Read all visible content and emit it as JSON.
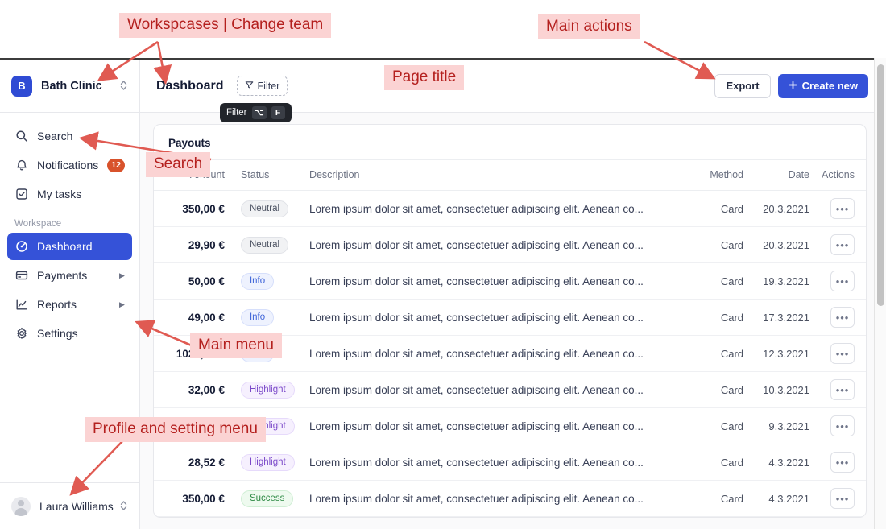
{
  "annotations": [
    {
      "id": "workspaces",
      "text": "Workspcases | Change team"
    },
    {
      "id": "main_actions",
      "text": "Main actions"
    },
    {
      "id": "page_title",
      "text": "Page title"
    },
    {
      "id": "search",
      "text": "Search"
    },
    {
      "id": "main_menu",
      "text": "Main menu"
    },
    {
      "id": "profile_menu",
      "text": "Profile and setting menu"
    }
  ],
  "sidebar": {
    "workspace": {
      "initial": "B",
      "name": "Bath Clinic",
      "switch_icon": "chevron-up-down-icon"
    },
    "top_items": [
      {
        "icon": "search-icon",
        "label": "Search"
      },
      {
        "icon": "bell-icon",
        "label": "Notifications",
        "badge": "12"
      },
      {
        "icon": "check-square-icon",
        "label": "My tasks"
      }
    ],
    "section_label": "Workspace",
    "workspace_items": [
      {
        "icon": "dashboard-icon",
        "label": "Dashboard",
        "active": true
      },
      {
        "icon": "card-icon",
        "label": "Payments",
        "expandable": true
      },
      {
        "icon": "chart-line-icon",
        "label": "Reports",
        "expandable": true
      },
      {
        "icon": "gear-icon",
        "label": "Settings"
      }
    ],
    "profile": {
      "name": "Laura Williams",
      "switch_icon": "chevron-up-down-icon"
    }
  },
  "topbar": {
    "title": "Dashboard",
    "filter_label": "Filter",
    "filter_icon": "funnel-icon",
    "tooltip": {
      "label": "Filter",
      "key1": "⌥",
      "key2": "F"
    },
    "export_label": "Export",
    "create_label": "Create new",
    "create_icon": "plus-icon"
  },
  "table": {
    "title": "Payouts",
    "columns": [
      "Amount",
      "Status",
      "Description",
      "Method",
      "Date",
      "Actions"
    ],
    "action_icon": "ellipsis-icon",
    "rows": [
      {
        "amount": "350,00 €",
        "status": "Neutral",
        "status_kind": "neutral",
        "description": "Lorem ipsum dolor sit amet, consectetuer adipiscing elit. Aenean co...",
        "method": "Card",
        "date": "20.3.2021"
      },
      {
        "amount": "29,90 €",
        "status": "Neutral",
        "status_kind": "neutral",
        "description": "Lorem ipsum dolor sit amet, consectetuer adipiscing elit. Aenean co...",
        "method": "Card",
        "date": "20.3.2021"
      },
      {
        "amount": "50,00 €",
        "status": "Info",
        "status_kind": "info",
        "description": "Lorem ipsum dolor sit amet, consectetuer adipiscing elit. Aenean co...",
        "method": "Card",
        "date": "19.3.2021"
      },
      {
        "amount": "49,00 €",
        "status": "Info",
        "status_kind": "info",
        "description": "Lorem ipsum dolor sit amet, consectetuer adipiscing elit. Aenean co...",
        "method": "Card",
        "date": "17.3.2021"
      },
      {
        "amount": "1023,00 €",
        "status": "Info",
        "status_kind": "info",
        "description": "Lorem ipsum dolor sit amet, consectetuer adipiscing elit. Aenean co...",
        "method": "Card",
        "date": "12.3.2021"
      },
      {
        "amount": "32,00 €",
        "status": "Highlight",
        "status_kind": "highlight",
        "description": "Lorem ipsum dolor sit amet, consectetuer adipiscing elit. Aenean co...",
        "method": "Card",
        "date": "10.3.2021"
      },
      {
        "amount": "",
        "status": "Highlight",
        "status_kind": "highlight",
        "description": "Lorem ipsum dolor sit amet, consectetuer adipiscing elit. Aenean co...",
        "method": "Card",
        "date": "9.3.2021"
      },
      {
        "amount": "28,52 €",
        "status": "Highlight",
        "status_kind": "highlight",
        "description": "Lorem ipsum dolor sit amet, consectetuer adipiscing elit. Aenean co...",
        "method": "Card",
        "date": "4.3.2021"
      },
      {
        "amount": "350,00 €",
        "status": "Success",
        "status_kind": "success",
        "description": "Lorem ipsum dolor sit amet, consectetuer adipiscing elit. Aenean co...",
        "method": "Card",
        "date": "4.3.2021"
      }
    ]
  },
  "colors": {
    "accent": "#3552d8",
    "annotation_bg": "#fbd3d3",
    "annotation_fg": "#b4201e",
    "badge": "#d8522b"
  }
}
